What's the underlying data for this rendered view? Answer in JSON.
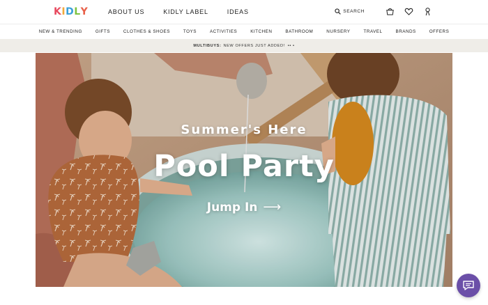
{
  "brand": {
    "logo_letters": [
      "K",
      "I",
      "D",
      "L",
      "Y"
    ],
    "logo_colors": [
      "#e84a5f",
      "#f2a93b",
      "#3aa0d8",
      "#7cc242",
      "#e8614a"
    ]
  },
  "header": {
    "nav": [
      "ABOUT US",
      "KIDLY LABEL",
      "IDEAS"
    ],
    "search_label": "SEARCH",
    "icons": [
      "search-icon",
      "basket-icon",
      "heart-icon",
      "account-icon"
    ]
  },
  "categories": [
    "NEW & TRENDING",
    "GIFTS",
    "CLOTHES & SHOES",
    "TOYS",
    "ACTIVITIES",
    "KITCHEN",
    "BATHROOM",
    "NURSERY",
    "TRAVEL",
    "BRANDS",
    "OFFERS"
  ],
  "promo": {
    "bold": "MULTIBUYS:",
    "text": "NEW OFFERS JUST ADDED!",
    "arrows": "•• •"
  },
  "hero": {
    "kicker": "Summer's Here",
    "headline": "Pool Party",
    "cta": "Jump In",
    "cta_arrow": "⟶"
  },
  "chat": {
    "icon": "chat-bubble-icon",
    "color": "#6b4fa8"
  }
}
